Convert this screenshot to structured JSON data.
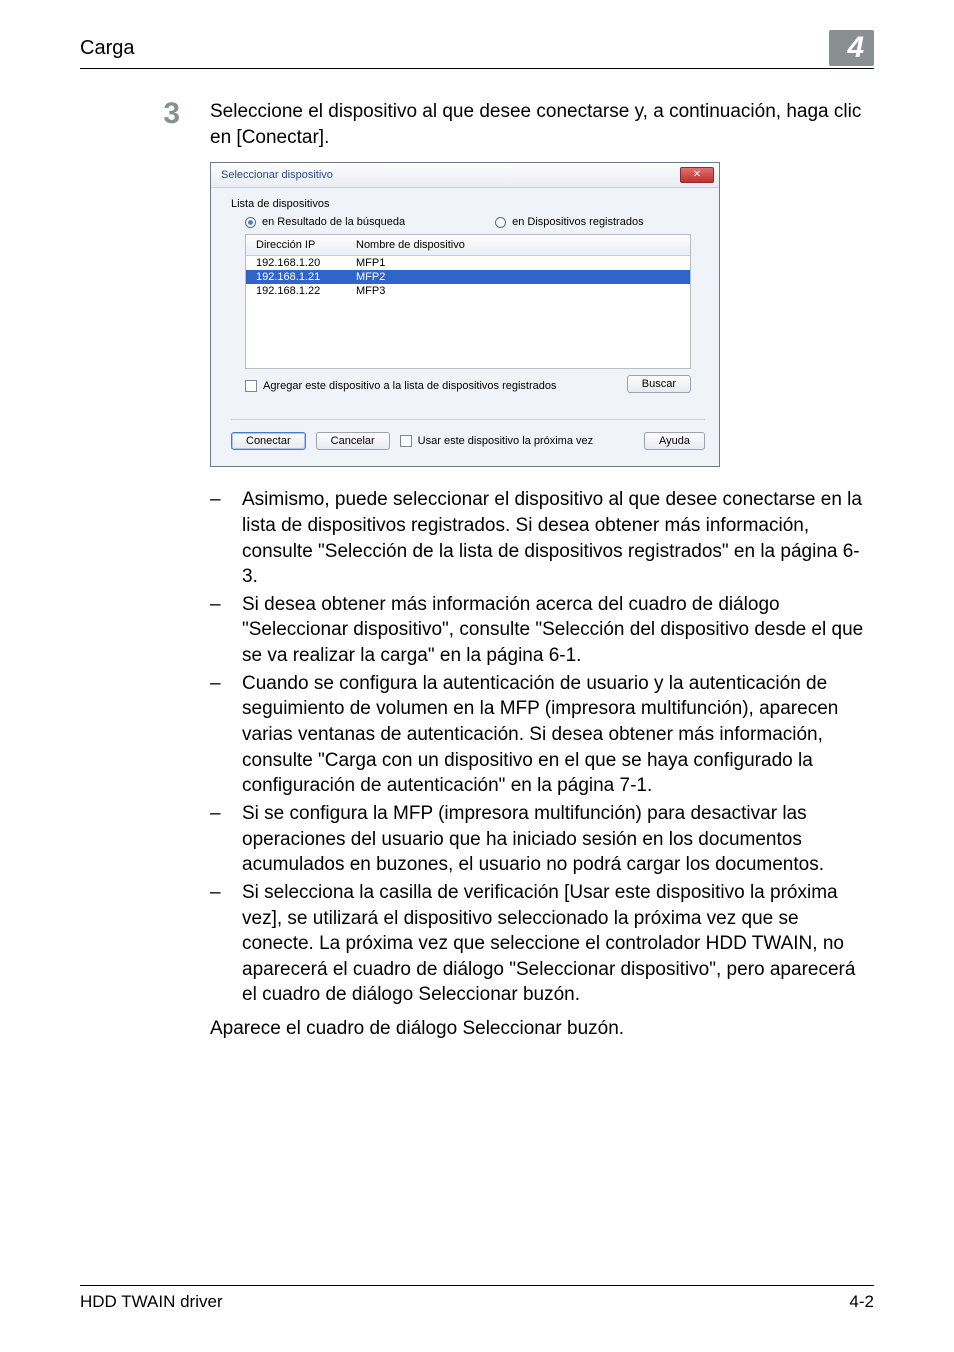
{
  "header": {
    "title": "Carga",
    "chapter": "4"
  },
  "step": {
    "num": "3",
    "text": "Seleccione el dispositivo al que desee conectarse y, a continuación, haga clic en [Conectar]."
  },
  "dialog": {
    "title": "Seleccionar dispositivo",
    "group_label": "Lista de dispositivos",
    "radio_search": "en Resultado de la búsqueda",
    "radio_registered": "en Dispositivos registrados",
    "col_ip": "Dirección IP",
    "col_name": "Nombre de dispositivo",
    "rows": [
      {
        "ip": "192.168.1.20",
        "name": "MFP1"
      },
      {
        "ip": "192.168.1.21",
        "name": "MFP2"
      },
      {
        "ip": "192.168.1.22",
        "name": "MFP3"
      }
    ],
    "add_label": "Agregar este dispositivo a la lista de dispositivos registrados",
    "search_btn": "Buscar",
    "connect_btn": "Conectar",
    "cancel_btn": "Cancelar",
    "next_time_label": "Usar este dispositivo la próxima vez",
    "help_btn": "Ayuda"
  },
  "bullets": [
    "Asimismo, puede seleccionar el dispositivo al que desee conectarse en la lista de dispositivos registrados. Si desea obtener más información, consulte \"Selección de la lista de dispositivos registrados\" en la página 6-3.",
    "Si desea obtener más información acerca del cuadro de diálogo \"Seleccionar dispositivo\", consulte \"Selección del dispositivo desde el que se va realizar la carga\" en la página 6-1.",
    "Cuando se configura la autenticación de usuario y la autenticación de seguimiento de volumen en la MFP (impresora multifunción), aparecen varias ventanas de autenticación. Si desea obtener más información, consulte \"Carga con un dispositivo en el que se haya configurado la configuración de autenticación\" en la página 7-1.",
    "Si se configura la MFP (impresora multifunción) para desactivar las operaciones del usuario que ha iniciado sesión en los documentos acumulados en buzones, el usuario no podrá cargar los documentos.",
    "Si selecciona la casilla de verificación [Usar este dispositivo la próxima vez], se utilizará el dispositivo seleccionado la próxima vez que se conecte. La próxima vez que seleccione el controlador HDD TWAIN, no aparecerá el cuadro de diálogo \"Seleccionar dispositivo\", pero aparecerá el cuadro de diálogo Seleccionar buzón."
  ],
  "after_text": "Aparece el cuadro de diálogo Seleccionar buzón.",
  "footer": {
    "left": "HDD TWAIN driver",
    "right": "4-2"
  }
}
